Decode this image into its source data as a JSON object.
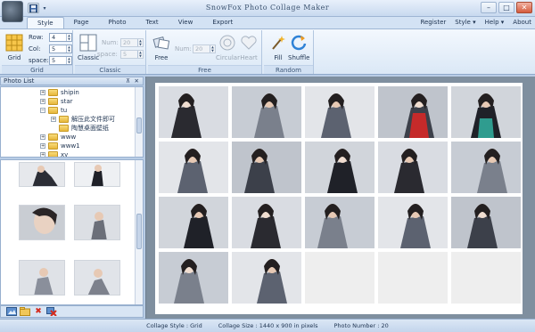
{
  "app": {
    "title": "SnowFox Photo Collage Maker"
  },
  "quick_access": {
    "save_icon": "save-icon",
    "menu_arrow": "▾"
  },
  "window_controls": {
    "minimize": "–",
    "maximize": "□",
    "close": "✕"
  },
  "tabs": [
    {
      "label": "Style",
      "active": true
    },
    {
      "label": "Page",
      "active": false
    },
    {
      "label": "Photo",
      "active": false
    },
    {
      "label": "Text",
      "active": false
    },
    {
      "label": "View",
      "active": false
    },
    {
      "label": "Export",
      "active": false
    }
  ],
  "right_menu": {
    "register": "Register",
    "style": "Style ▾",
    "help": "Help ▾",
    "about": "About"
  },
  "ribbon": {
    "grid_group": {
      "label": "Grid",
      "button": "Grid",
      "row_label": "Row:",
      "row_value": "4",
      "col_label": "Col:",
      "col_value": "5",
      "space_label": "space:",
      "space_value": "5"
    },
    "classic_group": {
      "label": "Classic",
      "button": "Classic",
      "num_label": "Num:",
      "num_value": "20",
      "space_label": "space:",
      "space_value": "5"
    },
    "free_group": {
      "label": "Free",
      "free_button": "Free",
      "num_label": "Num:",
      "num_value": "20",
      "circular_button": "Circular",
      "heart_button": "Heart"
    },
    "random_group": {
      "label": "Random",
      "fill_button": "Fill",
      "shuffle_button": "Shuffle"
    }
  },
  "photo_list": {
    "title": "Photo List",
    "pin": "⊼",
    "close": "✕",
    "tree": [
      {
        "label": "shipin",
        "indent": 1,
        "expander": "+",
        "has_folder": true
      },
      {
        "label": "star",
        "indent": 1,
        "expander": "+",
        "has_folder": true
      },
      {
        "label": "tu",
        "indent": 1,
        "expander": "−",
        "has_folder": true
      },
      {
        "label": "解压此文件即可",
        "indent": 2,
        "expander": "+",
        "has_folder": true
      },
      {
        "label": "陶慧桌面壁纸",
        "indent": 2,
        "expander": "",
        "has_folder": true
      },
      {
        "label": "www",
        "indent": 1,
        "expander": "+",
        "has_folder": true
      },
      {
        "label": "www1",
        "indent": 1,
        "expander": "+",
        "has_folder": true
      },
      {
        "label": "xy",
        "indent": 1,
        "expander": "+",
        "has_folder": true
      }
    ],
    "toolbar": [
      "add-folder-icon",
      "open-folder-icon",
      "delete-icon",
      "delete-all-icon"
    ]
  },
  "collage": {
    "rows": 4,
    "cols": 5,
    "filled_cells": 17
  },
  "status": {
    "style": "Collage Style : Grid",
    "size": "Collage Size : 1440 x 900  in pixels",
    "number": "Photo Number : 20"
  },
  "colors": {
    "ribbon_bg": "#dbe8f6",
    "canvas_bg": "#7f8f9f",
    "collage_bg": "#ffffff",
    "accent": "#2b6fd0"
  }
}
